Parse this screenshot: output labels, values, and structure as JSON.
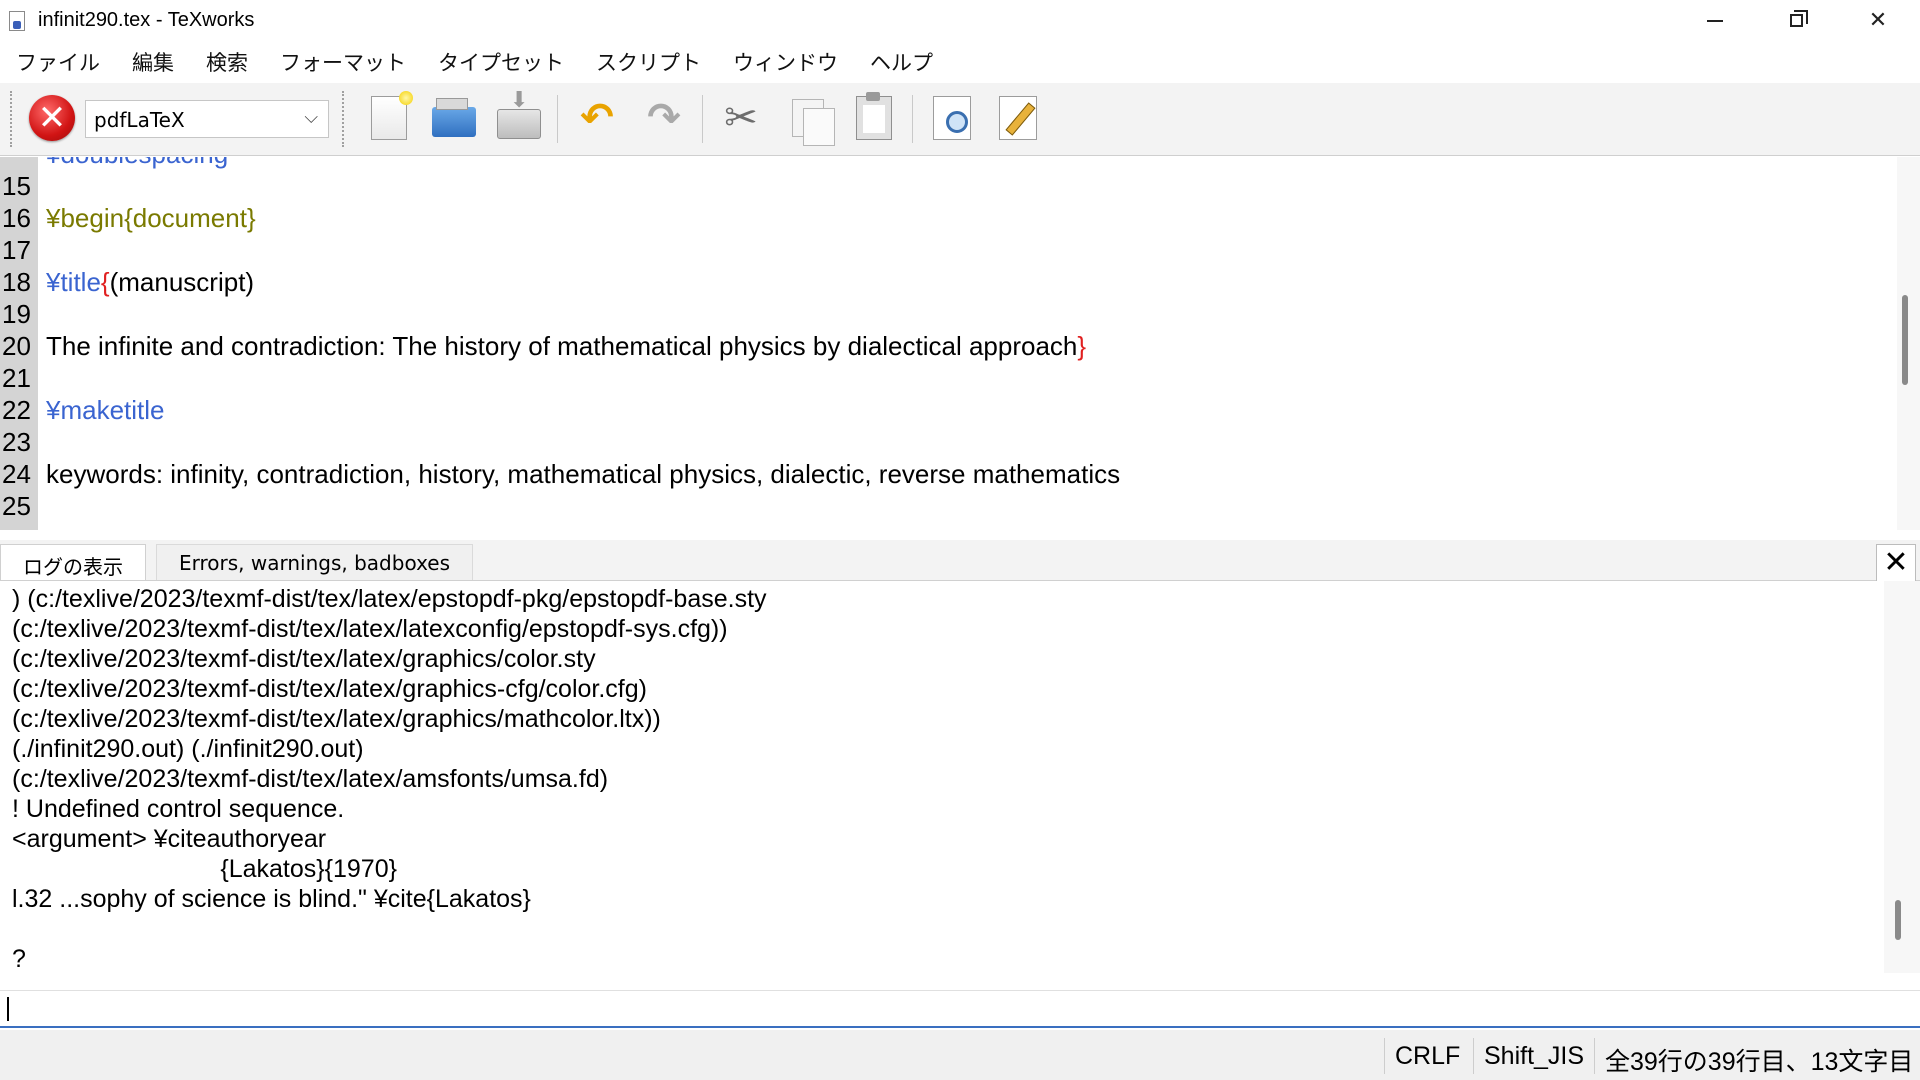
{
  "window": {
    "title": "infinit290.tex - TeXworks",
    "controls": [
      "minimize",
      "maximize",
      "close"
    ]
  },
  "menu": [
    "ファイル",
    "編集",
    "検索",
    "フォーマット",
    "タイプセット",
    "スクリプト",
    "ウィンドウ",
    "ヘルプ"
  ],
  "toolbar": {
    "engine": "pdfLaTeX",
    "icons": [
      "stop-typeset-icon",
      "new-document-icon",
      "open-folder-icon",
      "save-icon",
      "undo-icon",
      "redo-icon",
      "cut-icon",
      "copy-icon",
      "paste-icon",
      "find-preview-icon",
      "edit-pencil-icon"
    ],
    "stop_glyph": "✕",
    "undo_glyph": "↶",
    "redo_glyph": "↷",
    "cut_glyph": "✂"
  },
  "editor": {
    "partial_top_text": "¥doublespacing",
    "lines": [
      {
        "num": "15",
        "segments": []
      },
      {
        "num": "16",
        "segments": [
          {
            "t": "¥begin",
            "c": "env"
          },
          {
            "t": "{document}",
            "c": "env"
          }
        ]
      },
      {
        "num": "17",
        "segments": []
      },
      {
        "num": "18",
        "segments": [
          {
            "t": "¥title",
            "c": "cmd"
          },
          {
            "t": "{",
            "c": "brace"
          },
          {
            "t": "(manuscript)",
            "c": "plain"
          }
        ]
      },
      {
        "num": "19",
        "segments": []
      },
      {
        "num": "20",
        "segments": [
          {
            "t": "The infinite and contradiction: The history of mathematical physics by dialectical approach",
            "c": "plain"
          },
          {
            "t": "}",
            "c": "brace"
          }
        ]
      },
      {
        "num": "21",
        "segments": []
      },
      {
        "num": "22",
        "segments": [
          {
            "t": "¥maketitle",
            "c": "cmd"
          }
        ]
      },
      {
        "num": "23",
        "segments": []
      },
      {
        "num": "24",
        "segments": [
          {
            "t": "keywords: infinity, contradiction, history, mathematical physics, dialectic, reverse mathematics",
            "c": "plain"
          }
        ]
      },
      {
        "num": "25",
        "segments": []
      }
    ]
  },
  "log": {
    "tabs": [
      "ログの表示",
      "Errors, warnings, badboxes"
    ],
    "active_tab": 0,
    "close_glyph": "✕",
    "lines": [
      ") (c:/texlive/2023/texmf-dist/tex/latex/epstopdf-pkg/epstopdf-base.sty",
      "(c:/texlive/2023/texmf-dist/tex/latex/latexconfig/epstopdf-sys.cfg))",
      "(c:/texlive/2023/texmf-dist/tex/latex/graphics/color.sty",
      "(c:/texlive/2023/texmf-dist/tex/latex/graphics-cfg/color.cfg)",
      "(c:/texlive/2023/texmf-dist/tex/latex/graphics/mathcolor.ltx))",
      "(./infinit290.out) (./infinit290.out)",
      "(c:/texlive/2023/texmf-dist/tex/latex/amsfonts/umsa.fd)",
      "! Undefined control sequence.",
      "<argument> ¥citeauthoryear",
      "                              {Lakatos}{1970}",
      "l.32 ...sophy of science is blind.\" ¥cite{Lakatos}",
      "",
      "?"
    ]
  },
  "console": {
    "value": ""
  },
  "status": {
    "line_ending": "CRLF",
    "encoding": "Shift_JIS",
    "position": "全39行の39行目、13文字目"
  }
}
